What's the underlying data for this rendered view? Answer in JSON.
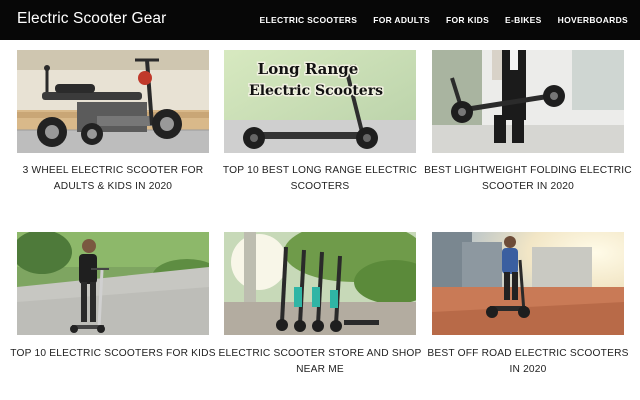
{
  "site": {
    "title": "Electric Scooter Gear"
  },
  "nav": {
    "items": [
      "ELECTRIC SCOOTERS",
      "FOR ADULTS",
      "FOR KIDS",
      "E-BIKES",
      "HOVERBOARDS"
    ]
  },
  "articles": [
    {
      "title": "3 WHEEL ELECTRIC SCOOTER FOR ADULTS & KIDS IN 2020",
      "image_icon": "three-wheel-scooter-image"
    },
    {
      "title": "TOP 10 BEST LONG RANGE ELECTRIC SCOOTERS",
      "image_icon": "long-range-scooter-image",
      "image_text_line1": "Long Range",
      "image_text_line2": "Electric Scooters"
    },
    {
      "title": "BEST LIGHTWEIGHT FOLDING ELECTRIC SCOOTER IN 2020",
      "image_icon": "folding-scooter-image"
    },
    {
      "title": "TOP 10 ELECTRIC SCOOTERS FOR KIDS",
      "image_icon": "kid-scooter-image"
    },
    {
      "title": "ELECTRIC SCOOTER STORE AND SHOP NEAR ME",
      "image_icon": "scooter-rack-image"
    },
    {
      "title": "BEST OFF ROAD ELECTRIC SCOOTERS IN 2020",
      "image_icon": "offroad-scooter-image"
    }
  ],
  "colors": {
    "header_bg": "#070707",
    "header_text": "#ffffff",
    "caption_text": "#222222"
  }
}
